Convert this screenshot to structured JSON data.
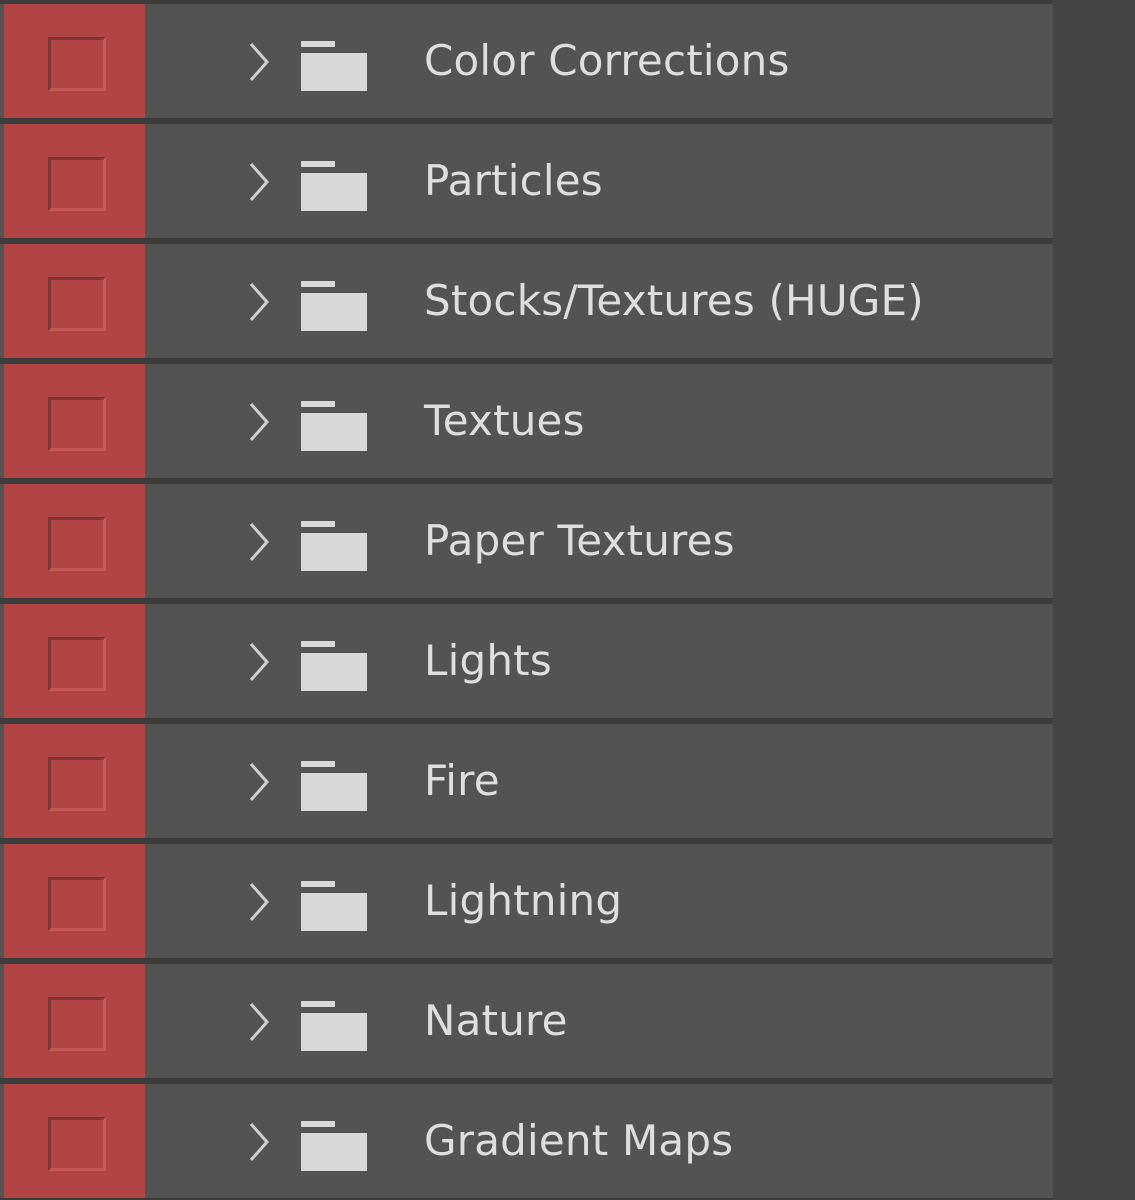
{
  "layers_panel": {
    "colors": {
      "row_background": "#535353",
      "visibility_cell": "#b24543",
      "text": "#dedede",
      "folder_icon": "#d8d8d8"
    },
    "groups": [
      {
        "label": "Color Corrections",
        "icon": "folder-icon",
        "expander": "chevron-right-icon"
      },
      {
        "label": "Particles",
        "icon": "folder-icon",
        "expander": "chevron-right-icon"
      },
      {
        "label": "Stocks/Textures (HUGE)",
        "icon": "folder-icon",
        "expander": "chevron-right-icon"
      },
      {
        "label": "Textues",
        "icon": "folder-icon",
        "expander": "chevron-right-icon"
      },
      {
        "label": "Paper Textures",
        "icon": "folder-icon",
        "expander": "chevron-right-icon"
      },
      {
        "label": "Lights",
        "icon": "folder-icon",
        "expander": "chevron-right-icon"
      },
      {
        "label": "Fire",
        "icon": "folder-icon",
        "expander": "chevron-right-icon"
      },
      {
        "label": "Lightning",
        "icon": "folder-icon",
        "expander": "chevron-right-icon"
      },
      {
        "label": "Nature",
        "icon": "folder-icon",
        "expander": "chevron-right-icon"
      },
      {
        "label": "Gradient Maps",
        "icon": "folder-icon",
        "expander": "chevron-right-icon"
      }
    ]
  }
}
